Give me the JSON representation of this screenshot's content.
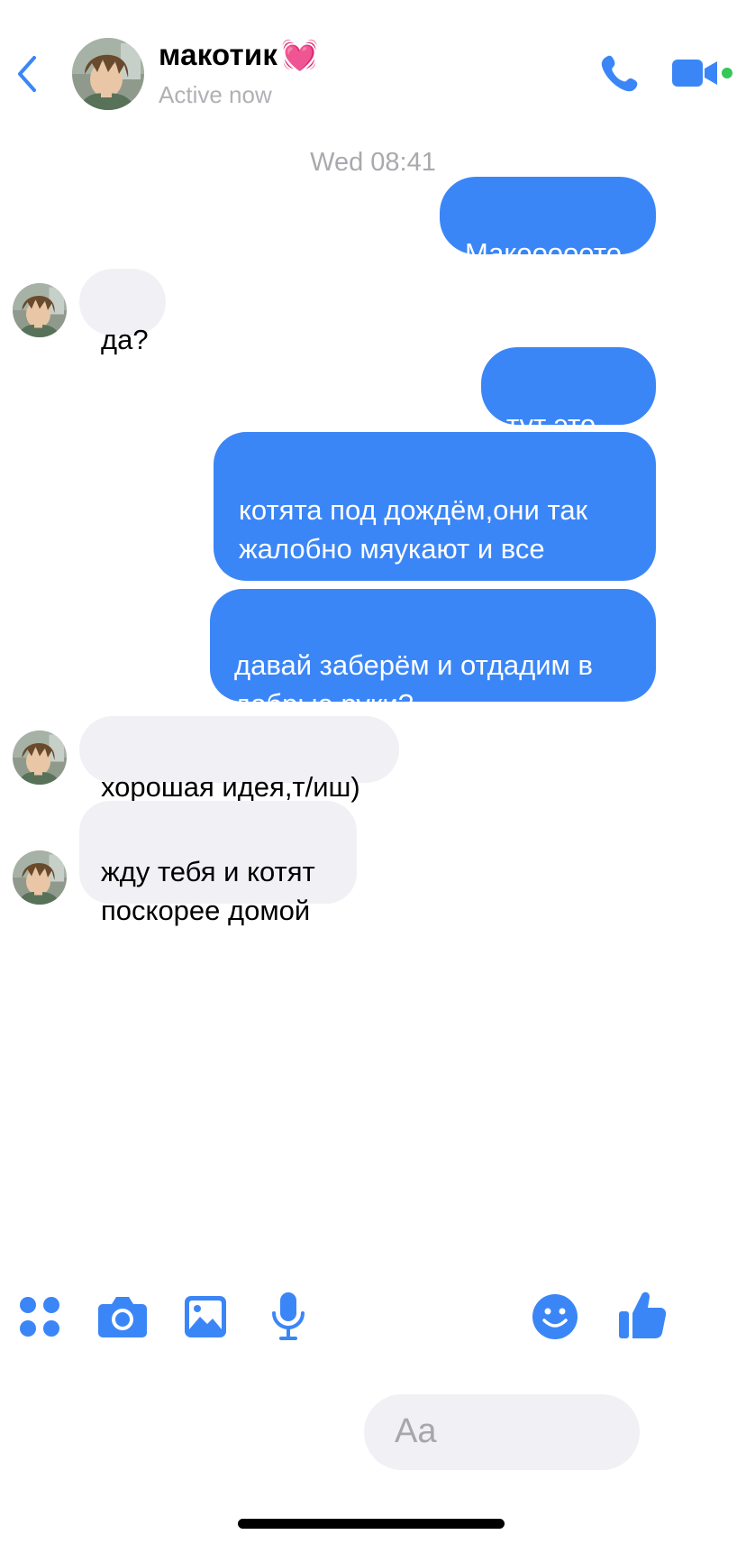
{
  "header": {
    "back_icon": "chevron-left-icon",
    "name": "макотик",
    "name_emoji": "💓",
    "status": "Active now",
    "call_icon": "phone-icon",
    "video_icon": "video-camera-icon",
    "active_dot_color": "#34c759"
  },
  "colors": {
    "accent": "#3b86f7",
    "incoming_bubble": "#f1f0f4",
    "timestamp": "#a9a9ae"
  },
  "conversation": {
    "timestamp": "Wed 08:41",
    "messages": [
      {
        "direction": "out",
        "text": "Макооооото"
      },
      {
        "direction": "in",
        "text": "да?"
      },
      {
        "direction": "out",
        "text": "тут это..."
      },
      {
        "direction": "out",
        "text": "котята под дождём,они так\nжалобно мяукают и все\nмокрые"
      },
      {
        "direction": "out",
        "text": "давай заберём и отдадим в\nдобрые руки?"
      },
      {
        "direction": "in",
        "text": "хорошая идея,т/иш)"
      },
      {
        "direction": "in",
        "text": "жду тебя и котят\nпоскорее домой"
      }
    ]
  },
  "composer": {
    "apps_icon": "four-dots-icon",
    "camera_icon": "camera-icon",
    "gallery_icon": "image-icon",
    "mic_icon": "microphone-icon",
    "placeholder": "Aa",
    "emoji_icon": "smiley-icon",
    "like_icon": "thumbs-up-icon"
  }
}
